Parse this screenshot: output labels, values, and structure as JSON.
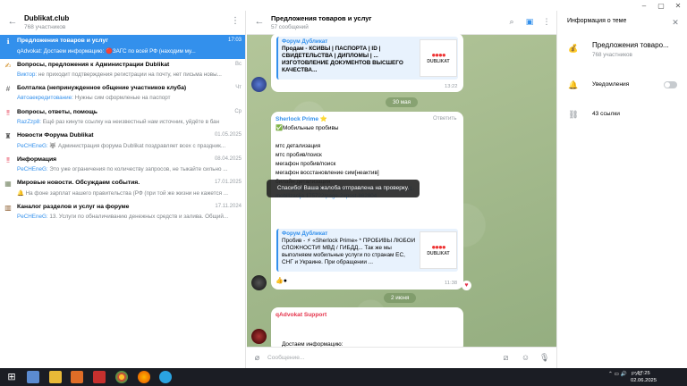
{
  "left_panel": {
    "title": "Dublikat.club",
    "subtitle": "768 участников",
    "chats": [
      {
        "icon": "ℹ",
        "name": "Предложения товаров и услуг",
        "date": "17:03",
        "author": "qAdvokat:",
        "preview": " Достаем информацию: 🔴ЗАГС по всей РФ (находим му..."
      },
      {
        "icon": "✍",
        "name": "Вопросы, предложения к Администрации Dublikat",
        "date": "Вс",
        "author": "Виктор:",
        "preview": " не приходит подтверждения регистрации на почту, нет письма новы..."
      },
      {
        "icon": "#",
        "name": "Болталка (непринужденное общение участников клуба)",
        "date": "Чт",
        "author": "Автоаекредитование:",
        "preview": " Нужны сим оформленые на паспорт"
      },
      {
        "icon": "‼",
        "name": "Вопросы, ответы, помощь",
        "date": "Ср",
        "author": "RazZzp8:",
        "preview": " Ещё раз кинуте ссылку на неизвестный нам источник, уйдёте в бан"
      },
      {
        "icon": "♜",
        "name": "Новости Форума Dublikat",
        "date": "01.05.2025",
        "author": "PeCHEnеG:",
        "preview": " 🐺 Администрация форума Dublikat поздравляет всех с праздник..."
      },
      {
        "icon": "‼",
        "name": "Информация",
        "date": "08.04.2025",
        "author": "PeCHEnеG:",
        "preview": " Это уже ограничения по количеству запросов, не тыкайте сильно ..."
      },
      {
        "icon": "▦",
        "name": "Мировые новости. Обсуждаем события.",
        "date": "17.01.2025",
        "author": "",
        "preview": "🔔 На фоне зарплат нашего правительства (РФ (при той же жизни не кажется ..."
      },
      {
        "icon": "▥",
        "name": "Каналог разделов и услуг на форуме",
        "date": "17.11.2024",
        "author": "PeCHEnеG:",
        "preview": " 13. Услуги по обналичиванию денежных средств и залива. Общий..."
      }
    ]
  },
  "chat": {
    "title": "Предложения товаров и услуг",
    "subtitle": "57 сообщений",
    "msg1": {
      "quote_title": "Форум Дубликат",
      "quote_body": "Продам - КСИВЫ | ПАСПОРТА | ID | СВИДЕТЕЛЬСТВА | ДИПЛОМЫ | ... ИЗГОТОВЛЕНИЕ ДОКУМЕНТОВ ВЫСШЕГО КАЧЕСТВА...",
      "time": "13:22"
    },
    "date1": "30 мая",
    "msg2": {
      "sender": "Sherlock Prime ⭐",
      "reply": "Ответить",
      "lines": [
        "✅Мобильные пробивы",
        "",
        "мтс детализация",
        "мтс пробив/поиск",
        "мегафон пробив/поиск",
        "мегафон восстановление сим[неактив]",
        "билайн детализация"
      ],
      "link": "...dka-ljuboj-...peratory-proverka-zapreta-na-vyezd-fz-31-mobilizacija.175722/page-2#post-862804",
      "quote_title": "Форум Дубликат",
      "quote_body": "Пробив - ⚡ «Sherlock Prime» * ПРОБИВЫ ЛЮБОЙ СЛОЖНОСТИ! МВД / ГИБДД... Так же мы выполняем мобильные услуги по странам ЕС, СНГ и Украине. При обращении ...",
      "time": "11:38"
    },
    "date2": "2 июня",
    "msg3": {
      "sender": "qAdvokat Support",
      "text": "Достаем информацию:"
    },
    "toast": "Спасибо! Ваша жалоба отправлена на проверку.",
    "compose_placeholder": "Сообщение..."
  },
  "right_panel": {
    "title": "Информация о теме",
    "group_name": "Предложения товаро...",
    "group_sub": "768 участников",
    "notifications": "Уведомления",
    "links": "43 ссылки"
  },
  "logo_word": "DUBLIKAT",
  "taskbar": {
    "lang": "РУС",
    "time": "17:25",
    "date": "02.06.2025"
  },
  "colors": {
    "accent": "#3390ec",
    "chat_bg": "#9fb58a",
    "taskbar": "#1b1d24"
  }
}
